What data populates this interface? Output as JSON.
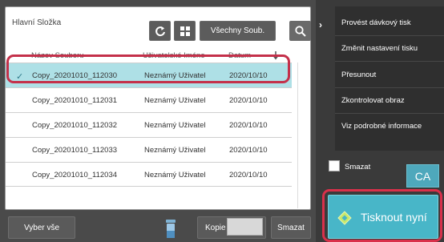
{
  "window": {
    "folder_title": "Hlavní Složka",
    "filter_label": "Všechny Soub."
  },
  "icons": {
    "refresh": "refresh-icon",
    "grid": "grid-view-icon",
    "search": "search-icon",
    "sort": "sort-arrow-icon",
    "check": "check-icon",
    "bin": "bin-icon",
    "print": "print-icon",
    "chevron": "chevron-right-icon"
  },
  "table": {
    "columns": [
      "Název Souboru",
      "Uživatelské Iméno",
      "Datum"
    ],
    "rows": [
      {
        "name": "Copy_20201010_112030",
        "user": "Neznámý Uživatel",
        "date": "2020/10/10",
        "selected": true
      },
      {
        "name": "Copy_20201010_112031",
        "user": "Neznámý Uživatel",
        "date": "2020/10/10",
        "selected": false
      },
      {
        "name": "Copy_20201010_112032",
        "user": "Neznámý Uživatel",
        "date": "2020/10/10",
        "selected": false
      },
      {
        "name": "Copy_20201010_112033",
        "user": "Neznámý Uživatel",
        "date": "2020/10/10",
        "selected": false
      },
      {
        "name": "Copy_20201010_112034",
        "user": "Neznámý Uživatel",
        "date": "2020/10/10",
        "selected": false
      }
    ]
  },
  "bottom_bar": {
    "select_all": "Vyber vše",
    "copies_label": "Kopie",
    "delete": "Smazat"
  },
  "side_menu": {
    "items": [
      "Provést dávkový tisk",
      "Změnit nastavení tisku",
      "Přesunout",
      "Zkontrolovat obraz",
      "Viz podrobné informace"
    ]
  },
  "right_controls": {
    "delete_checkbox_label": "Smazat",
    "ca": "CA",
    "print_now": "Tisknout nyní"
  },
  "colors": {
    "selected_row": "#aee0e6",
    "highlight_frame": "#d9304a",
    "print_button": "#48b6c8"
  }
}
